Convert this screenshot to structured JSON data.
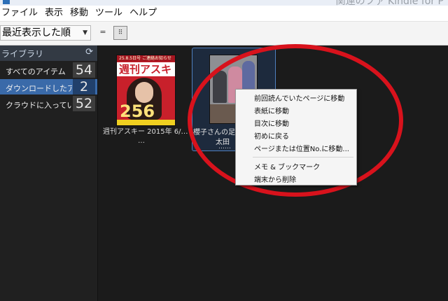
{
  "title_bar": {
    "text": "関連のファ Kindle for P"
  },
  "menu": [
    "ファイル",
    "表示",
    "移動",
    "ツール",
    "ヘルプ"
  ],
  "toolbar": {
    "sort_selected": "最近表示した順",
    "list_view_icon": "=",
    "grid_view_icon": "⠿"
  },
  "sidebar": {
    "header": "ライブラリ",
    "refresh_icon": "⟳",
    "items": [
      {
        "label": "すべてのアイテム",
        "count": "54",
        "active": false
      },
      {
        "label": "ダウンロードしたアイテム",
        "count": "2",
        "active": true
      },
      {
        "label": "クラウドに入っているアイテム",
        "count": "52",
        "active": false
      }
    ]
  },
  "books": [
    {
      "title": "週刊アスキー 2015年 6/…",
      "more": "…",
      "cover": {
        "masthead": "週刊アスキー",
        "strap": "25.8.5日号 ご連絡お知らせ",
        "number": "256"
      }
    },
    {
      "title": "櫻子さんの足下には…",
      "author": "太田",
      "more": "……",
      "selected": true
    }
  ],
  "context_menu": {
    "items": [
      "前回読んでいたページに移動",
      "表紙に移動",
      "目次に移動",
      "初めに戻る",
      "ページまたは位置No.に移動...",
      "メモ & ブックマーク",
      "端末から削除"
    ]
  },
  "colors": {
    "accent_blue": "#3a6aa9",
    "annotation_red": "#d8121c",
    "content_bg": "#1b1b1b"
  }
}
